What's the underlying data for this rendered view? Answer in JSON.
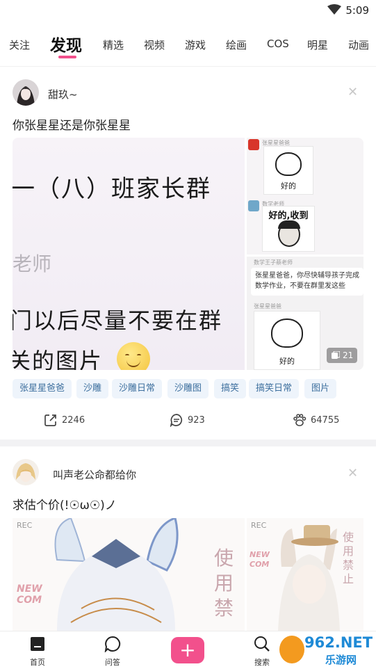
{
  "status": {
    "time": "5:09"
  },
  "nav": {
    "tabs": [
      "关注",
      "发现",
      "精选",
      "视频",
      "游戏",
      "绘画",
      "COS",
      "明星",
      "动画"
    ],
    "active_index": 1,
    "accent": "#f2508c"
  },
  "post1": {
    "username": "甜玖~",
    "text": "你张星星还是你张星星",
    "image_main": {
      "line1": "一（八）班家长群",
      "line2": "老师",
      "line3": "门以后尽量不要在群",
      "line4": "关的图片"
    },
    "image_side_top": {
      "sender1": "张星星爸爸",
      "sticker1_caption": "好的",
      "sender2": "数学老师",
      "sticker2_caption": "好的,收到"
    },
    "image_side_bottom": {
      "sender1": "数学王子蔡老师",
      "message": "张星星爸爸，你尽快辅导孩子完成数学作业，不要在群里发这些",
      "sender2": "张星星爸爸",
      "sticker_caption": "好的"
    },
    "image_count": "21",
    "tags": [
      "张星星爸爸",
      "沙雕",
      "沙雕日常",
      "沙雕图",
      "搞笑",
      "搞笑日常",
      "图片"
    ],
    "shares": "2246",
    "comments": "923",
    "likes": "64755"
  },
  "post2": {
    "username": "叫声老公命都给你",
    "text": "求估个价(!☉ω☉)ノ",
    "image_left": {
      "rec": "REC",
      "big": "使用禁",
      "side": "NEW COM"
    },
    "image_right": {
      "rec": "REC",
      "big": "使用禁止",
      "side": "NEW COM"
    }
  },
  "bottom_nav": {
    "home": "首页",
    "qa": "问答",
    "search": "搜索"
  },
  "watermark": {
    "top": "962.NET",
    "bottom": "乐游网"
  }
}
